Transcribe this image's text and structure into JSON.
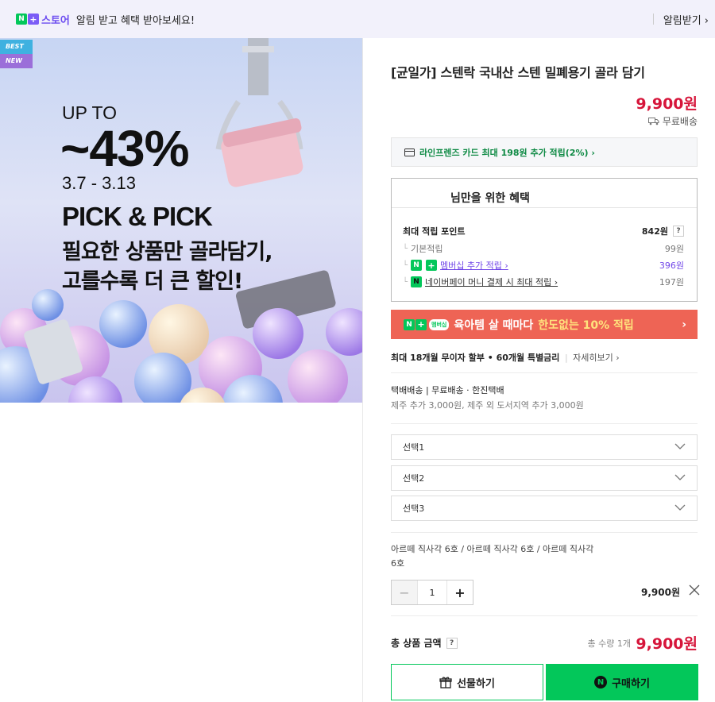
{
  "topbar": {
    "logo_n": "N",
    "logo_plus": "+",
    "store": "스토어",
    "message": "알림 받고 혜택 받아보세요!",
    "alarm_button": "알림받기 ›"
  },
  "banner": {
    "tag_best": "BEST",
    "tag_new": "NEW",
    "up_to": "UP TO",
    "percent": "~43%",
    "dates": "3.7 - 3.13",
    "pick": "PICK & PICK",
    "line1": "필요한 상품만 골라담기,",
    "line2": "고를수록 더 큰 할인!"
  },
  "product": {
    "title": "[균일가] 스텐락 국내산 스텐 밀폐용기 골라 담기",
    "price": "9,900원",
    "shipping": "무료배송",
    "card_promo": "라인프렌즈 카드 최대 198원 추가 적립(2%) ›"
  },
  "benefit": {
    "title": "님만을 위한 혜택",
    "max_points_label": "최대 적립 포인트",
    "max_points_value": "842원",
    "qmark": "?",
    "basic_label": "기본적립",
    "basic_value": "99원",
    "membership_label": "멤버십 추가 적립 ›",
    "membership_value": "396원",
    "pay_label": "네이버페이 머니 결제 시 최대 적립 ›",
    "pay_value": "197원",
    "elbow": "└"
  },
  "promo": {
    "membership_tag": "멤버십",
    "text": "육아템 살 때마다",
    "highlight": "한도없는 10% 적립",
    "arrow": "›"
  },
  "installment": {
    "text": "최대 18개월 무이자 할부 • 60개월 특별금리",
    "more": "자세히보기 ›"
  },
  "delivery": {
    "line1": "택배배송  |  무료배송  ·  한진택배",
    "line2": "제주 추가 3,000원, 제주 외 도서지역 추가 3,000원"
  },
  "selects": [
    {
      "label": "선택1"
    },
    {
      "label": "선택2"
    },
    {
      "label": "선택3"
    }
  ],
  "option": {
    "name": "아르떼 직사각 6호 / 아르떼 직사각 6호 / 아르떼 직사각 6호",
    "minus": "−",
    "quantity": "1",
    "plus": "+",
    "price": "9,900원"
  },
  "total": {
    "label": "총 상품 금액",
    "qmark": "?",
    "qty_text": "총 수량 1개",
    "price": "9,900원"
  },
  "buttons": {
    "gift": "선물하기",
    "buy_icon": "N",
    "buy": "구매하기"
  },
  "colors": {
    "accent_green": "#03c75a",
    "price_red": "#d6153a",
    "promo_red": "#ee6455",
    "purple": "#7045e8"
  },
  "icons": [
    "truck-icon",
    "card-icon",
    "chevron-down-icon",
    "close-icon",
    "gift-icon",
    "naver-n-icon"
  ]
}
